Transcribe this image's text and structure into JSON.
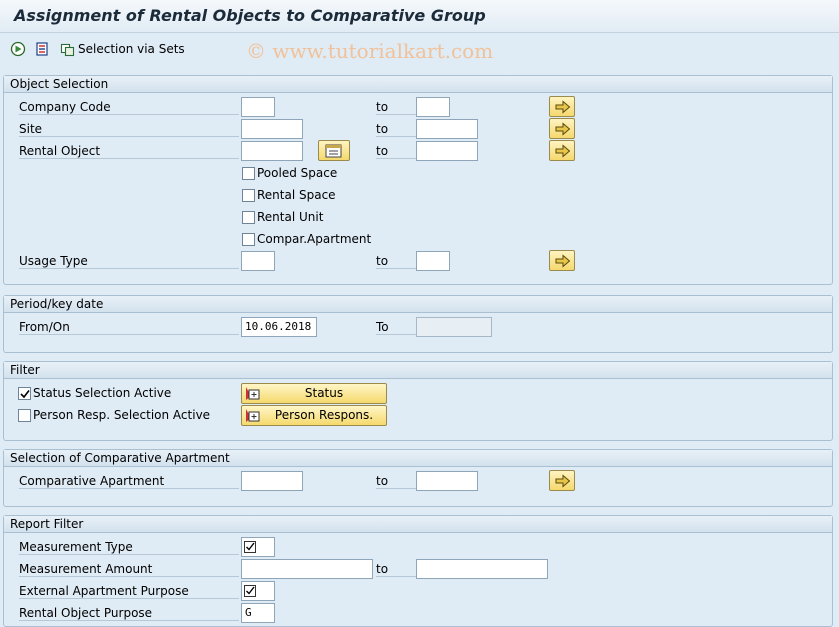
{
  "window": {
    "title": "Assignment of Rental Objects to Comparative Group",
    "watermark": "© www.tutorialkart.com"
  },
  "toolbar": {
    "execute_icon": "execute-icon",
    "variant_icon": "get-variant-icon",
    "selection_sets_label": "Selection via Sets"
  },
  "object_selection": {
    "heading": "Object Selection",
    "to_label": "to",
    "company_code": {
      "label": "Company Code",
      "from": "",
      "to": ""
    },
    "site": {
      "label": "Site",
      "from": "",
      "to": ""
    },
    "rental_object": {
      "label": "Rental Object",
      "from": "",
      "to": ""
    },
    "pooled_space": {
      "label": "Pooled Space",
      "checked": false
    },
    "rental_space": {
      "label": "Rental Space",
      "checked": false
    },
    "rental_unit": {
      "label": "Rental Unit",
      "checked": false
    },
    "compar_apartment": {
      "label": "Compar.Apartment",
      "checked": false
    },
    "usage_type": {
      "label": "Usage Type",
      "from": "",
      "to": ""
    }
  },
  "period": {
    "heading": "Period/key date",
    "from_label": "From/On",
    "from_value": "10.06.2018",
    "to_label": "To",
    "to_value": ""
  },
  "filter": {
    "heading": "Filter",
    "status_active": {
      "label": "Status Selection Active",
      "checked": true
    },
    "person_active": {
      "label": "Person Resp. Selection Active",
      "checked": false
    },
    "status_button": "Status",
    "person_button": "Person Respons."
  },
  "comparative": {
    "heading": "Selection of Comparative Apartment",
    "label": "Comparative Apartment",
    "to_label": "to",
    "from": "",
    "to": ""
  },
  "report_filter": {
    "heading": "Report Filter",
    "measurement_type": {
      "label": "Measurement Type",
      "checked": true
    },
    "measurement_amount": {
      "label": "Measurement Amount",
      "from": "",
      "to": ""
    },
    "to_label": "to",
    "external_purpose": {
      "label": "External Apartment Purpose",
      "checked": true
    },
    "rental_object_purpose": {
      "label": "Rental Object Purpose",
      "value": "G"
    }
  },
  "colors": {
    "background": "#dfebf5",
    "button_yellow": "#f5d96d",
    "title_text": "#1c2b3a"
  }
}
